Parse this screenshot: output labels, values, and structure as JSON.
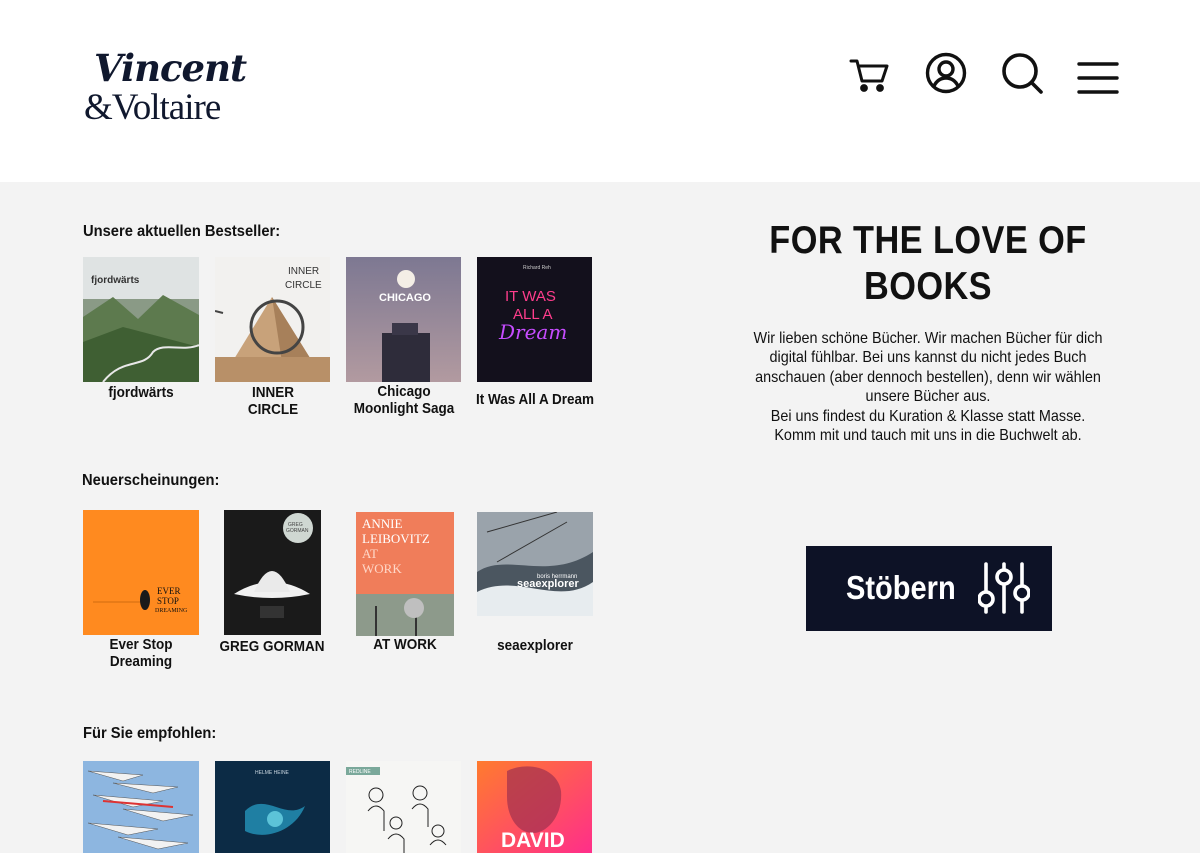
{
  "brand": {
    "line1": "Vincent",
    "line2": "&Voltaire"
  },
  "header_icons": [
    "cart-icon",
    "account-icon",
    "search-icon",
    "menu-icon"
  ],
  "sections": {
    "bestsellers": {
      "title": "Unsere aktuellen Bestseller:",
      "books": [
        {
          "title": "fjordwärts",
          "cover_text": "fjordwärts"
        },
        {
          "title": "INNER\nCIRCLE",
          "cover_text": "INNER\nCIRCLE"
        },
        {
          "title": "Chicago\nMoonlight Saga",
          "cover_text": "CHICAGO"
        },
        {
          "title": "It Was All A Dream",
          "cover_text": "IT WAS ALL A Dream",
          "cover_author": "Richard Reh"
        }
      ]
    },
    "new_releases": {
      "title": "Neuerscheinungen:",
      "books": [
        {
          "title": "Ever Stop\nDreaming",
          "cover_text": "EVER STOP DREAMING"
        },
        {
          "title": "GREG GORMAN",
          "cover_text": "GREG GORMAN"
        },
        {
          "title": "AT WORK",
          "cover_text": "ANNIE LEIBOVITZ AT WORK"
        },
        {
          "title": "seaexplorer",
          "cover_text": "seaexplorer",
          "cover_author": "boris herrmann"
        }
      ]
    },
    "recommended": {
      "title": "Für Sie empfohlen:",
      "books": [
        {
          "title": "",
          "cover_text": ""
        },
        {
          "title": "",
          "cover_text": "HELME HEINE"
        },
        {
          "title": "",
          "cover_text": "REDLINE"
        },
        {
          "title": "",
          "cover_text": "DAVID"
        }
      ]
    }
  },
  "hero": {
    "title": "FOR THE LOVE OF BOOKS",
    "text": "Wir lieben schöne Bücher. Wir machen Bücher für dich digital fühlbar. Bei uns kannst du nicht jedes Buch anschauen (aber dennoch bestellen), denn wir wählen unsere Bücher aus.\nBei uns findest du Kuration & Klasse statt Masse.\nKomm mit und tauch mit uns in die Buchwelt ab."
  },
  "browse_button": {
    "label": "Stöbern",
    "icon": "sliders-icon"
  },
  "colors": {
    "brand_navy": "#0d1226",
    "page_bg": "#f3f3f3",
    "header_bg": "#ffffff"
  }
}
